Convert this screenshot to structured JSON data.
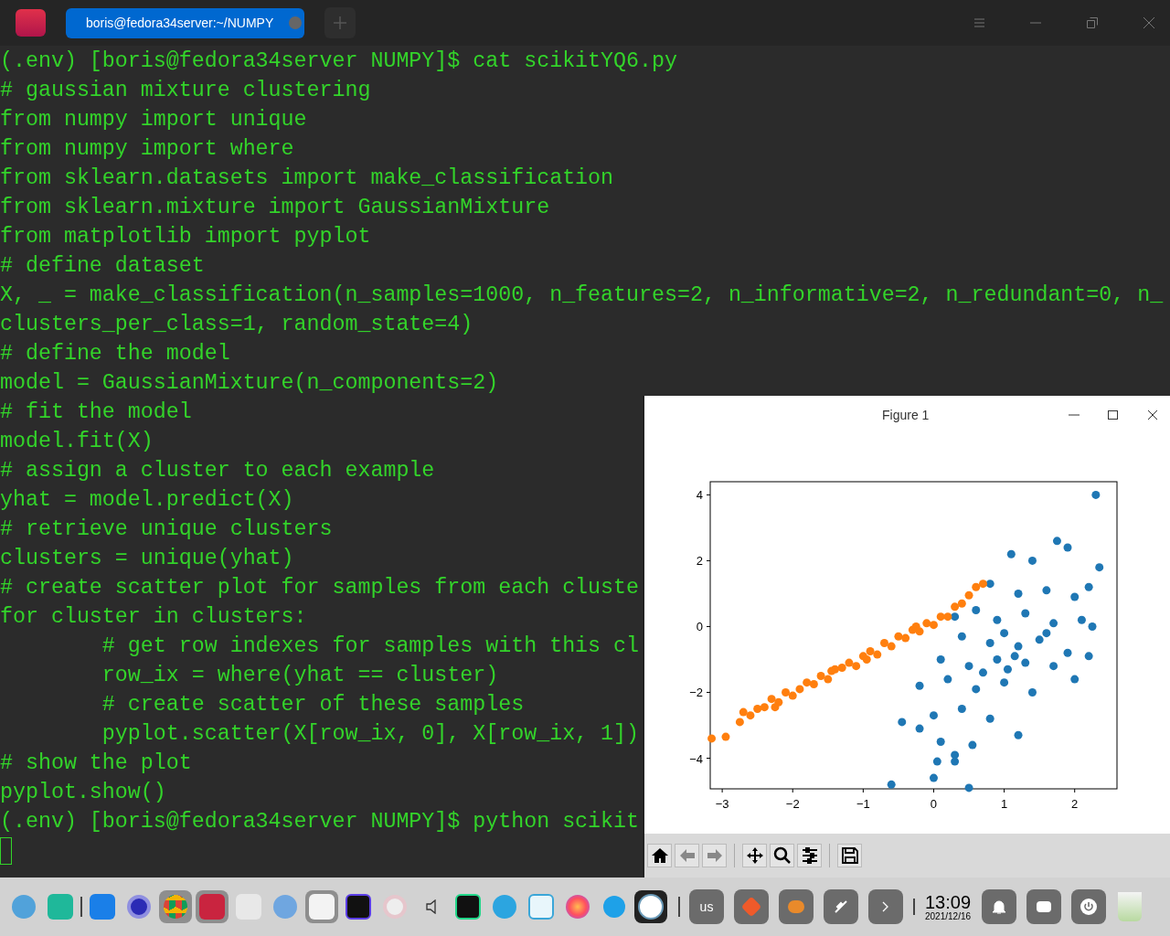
{
  "tab": {
    "title": "boris@fedora34server:~/NUMPY",
    "selected": true
  },
  "terminal": {
    "lines": [
      "(.env) [boris@fedora34server NUMPY]$ cat scikitYQ6.py",
      "# gaussian mixture clustering",
      "from numpy import unique",
      "from numpy import where",
      "from sklearn.datasets import make_classification",
      "from sklearn.mixture import GaussianMixture",
      "from matplotlib import pyplot",
      "# define dataset",
      "X, _ = make_classification(n_samples=1000, n_features=2, n_informative=2, n_redundant=0, n_",
      "clusters_per_class=1, random_state=4)",
      "# define the model",
      "model = GaussianMixture(n_components=2)",
      "# fit the model",
      "model.fit(X)",
      "# assign a cluster to each example",
      "yhat = model.predict(X)",
      "# retrieve unique clusters",
      "clusters = unique(yhat)",
      "# create scatter plot for samples from each cluste",
      "for cluster in clusters:",
      "        # get row indexes for samples with this cl",
      "        row_ix = where(yhat == cluster)",
      "        # create scatter of these samples",
      "        pyplot.scatter(X[row_ix, 0], X[row_ix, 1])",
      "# show the plot",
      "pyplot.show()",
      "(.env) [boris@fedora34server NUMPY]$ python scikit"
    ]
  },
  "figure": {
    "title": "Figure 1",
    "chart_data": {
      "type": "scatter",
      "xlim": [
        -3.17,
        2.6
      ],
      "ylim": [
        -4.93,
        4.4
      ],
      "xticks": [
        {
          "value": -3,
          "label": "−3"
        },
        {
          "value": -2,
          "label": "−2"
        },
        {
          "value": -1,
          "label": "−1"
        },
        {
          "value": 0,
          "label": "0"
        },
        {
          "value": 1,
          "label": "1"
        },
        {
          "value": 2,
          "label": "2"
        }
      ],
      "yticks": [
        {
          "value": -4,
          "label": "−4"
        },
        {
          "value": -2,
          "label": "−2"
        },
        {
          "value": 0,
          "label": "0"
        },
        {
          "value": 2,
          "label": "2"
        },
        {
          "value": 4,
          "label": "4"
        }
      ],
      "series": [
        {
          "color": "#1f77b4",
          "x": [
            2.3,
            1.75,
            1.9,
            2.35,
            2.2,
            1.1,
            1.4,
            0.8,
            1.2,
            1.6,
            2.0,
            0.3,
            0.6,
            0.9,
            1.3,
            1.7,
            2.1,
            2.25,
            0.4,
            0.8,
            1.0,
            1.2,
            1.5,
            1.9,
            2.2,
            0.1,
            0.5,
            0.9,
            1.3,
            1.7,
            2.0,
            -0.2,
            0.2,
            0.6,
            1.0,
            1.4,
            -0.45,
            0.0,
            0.4,
            0.8,
            1.2,
            -0.2,
            0.1,
            0.3,
            0.55,
            0.05,
            0.3,
            0.0,
            -0.6,
            0.5,
            1.05,
            1.15,
            0.7,
            1.6
          ],
          "values": [
            4.0,
            2.6,
            2.4,
            1.8,
            1.2,
            2.2,
            2.0,
            1.3,
            1.0,
            1.1,
            0.9,
            0.3,
            0.5,
            0.2,
            0.4,
            0.1,
            0.2,
            0.0,
            -0.3,
            -0.5,
            -0.2,
            -0.6,
            -0.4,
            -0.8,
            -0.9,
            -1.0,
            -1.2,
            -1.0,
            -1.1,
            -1.2,
            -1.6,
            -1.8,
            -1.6,
            -1.9,
            -1.7,
            -2.0,
            -2.9,
            -2.7,
            -2.5,
            -2.8,
            -3.3,
            -3.1,
            -3.5,
            -3.9,
            -3.6,
            -4.1,
            -4.1,
            -4.6,
            -4.8,
            -4.9,
            -1.3,
            -0.9,
            -1.4,
            -0.2
          ]
        },
        {
          "color": "#ff7f0e",
          "x": [
            -3.15,
            -2.95,
            -2.75,
            -2.7,
            -2.6,
            -2.5,
            -2.4,
            -2.3,
            -2.2,
            -2.1,
            -2.0,
            -1.9,
            -1.8,
            -1.7,
            -1.6,
            -1.5,
            -1.4,
            -1.3,
            -1.2,
            -1.1,
            -1.0,
            -0.9,
            -0.8,
            -0.7,
            -0.6,
            -0.5,
            -0.4,
            -0.3,
            -0.2,
            -0.1,
            0.0,
            0.1,
            0.2,
            0.3,
            0.4,
            0.5,
            0.6,
            0.7,
            -1.45,
            -0.95,
            -0.25,
            -2.25
          ],
          "values": [
            -3.4,
            -3.35,
            -2.9,
            -2.6,
            -2.7,
            -2.5,
            -2.45,
            -2.2,
            -2.3,
            -2.0,
            -2.1,
            -1.9,
            -1.7,
            -1.75,
            -1.5,
            -1.6,
            -1.3,
            -1.25,
            -1.1,
            -1.2,
            -0.9,
            -0.75,
            -0.85,
            -0.5,
            -0.6,
            -0.3,
            -0.35,
            -0.1,
            -0.15,
            0.1,
            0.05,
            0.3,
            0.3,
            0.6,
            0.7,
            0.95,
            1.2,
            1.3,
            -1.35,
            -1.0,
            0.0,
            -2.45
          ]
        }
      ]
    }
  },
  "taskbar": {
    "apps": [
      {
        "kind": "fedora",
        "selected": false
      },
      {
        "kind": "files",
        "selected": false
      },
      {
        "kind": "store",
        "selected": false
      },
      {
        "kind": "gear",
        "selected": false
      },
      {
        "kind": "chrome",
        "selected": true
      },
      {
        "kind": "terminal",
        "selected": true
      },
      {
        "kind": "vim",
        "selected": false
      },
      {
        "kind": "qb",
        "selected": false
      },
      {
        "kind": "notes",
        "selected": true
      },
      {
        "kind": "ij",
        "selected": false
      },
      {
        "kind": "disc",
        "selected": false
      },
      {
        "kind": "speaker",
        "selected": false
      },
      {
        "kind": "pc",
        "selected": false
      },
      {
        "kind": "telegram",
        "selected": false
      },
      {
        "kind": "monitor",
        "selected": false
      },
      {
        "kind": "firefox",
        "selected": false
      },
      {
        "kind": "skype",
        "selected": false
      },
      {
        "kind": "plotapp",
        "selected": true
      }
    ],
    "keyboard_layout": "us",
    "time": "13:09",
    "date": "2021/12/16"
  }
}
